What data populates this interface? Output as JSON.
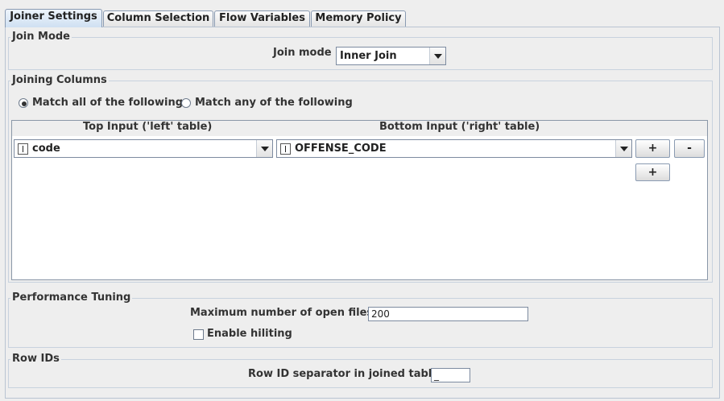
{
  "tabs": [
    {
      "label": "Joiner Settings"
    },
    {
      "label": "Column Selection"
    },
    {
      "label": "Flow Variables"
    },
    {
      "label": "Memory Policy"
    }
  ],
  "join_mode": {
    "group_title": "Join Mode",
    "label": "Join mode",
    "value": "Inner Join"
  },
  "joining_columns": {
    "group_title": "Joining Columns",
    "radio_all": "Match all of the following",
    "radio_any": "Match any of the following",
    "selected": "all",
    "header_left": "Top Input ('left' table)",
    "header_right": "Bottom Input ('right' table)",
    "rows": [
      {
        "left": "code",
        "right": "OFFENSE_CODE"
      }
    ],
    "add_label": "+",
    "remove_label": "-"
  },
  "performance": {
    "group_title": "Performance Tuning",
    "max_files_label": "Maximum number of open files:",
    "max_files_value": "200",
    "hiliting_label": "Enable hiliting",
    "hiliting_checked": false
  },
  "row_ids": {
    "group_title": "Row IDs",
    "separator_label": "Row ID separator in joined table:",
    "separator_value": "_"
  }
}
